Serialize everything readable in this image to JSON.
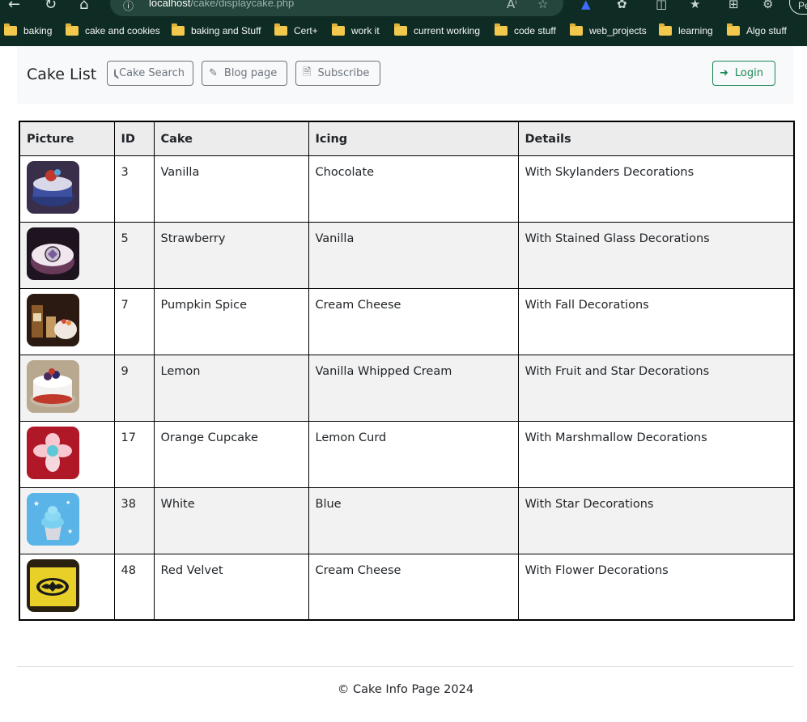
{
  "browser": {
    "url_host": "localhost",
    "url_path": "/cake/displaycake.php",
    "profile_label": "Pe",
    "bookmarks": [
      "baking",
      "cake and cookies",
      "baking and Stuff",
      "Cert+",
      "work it",
      "current working",
      "code stuff",
      "web_projects",
      "learning",
      "Algo stuff"
    ]
  },
  "navbar": {
    "brand": "Cake List",
    "search_label": "Cake Search",
    "blog_label": "Blog page",
    "subscribe_label": "Subscribe",
    "login_label": "Login",
    "login_color": "#198754"
  },
  "table": {
    "headers": [
      "Picture",
      "ID",
      "Cake",
      "Icing",
      "Details"
    ],
    "rows": [
      {
        "id": "3",
        "cake": "Vanilla",
        "icing": "Chocolate",
        "details": "With Skylanders Decorations",
        "picture": "cake-photo"
      },
      {
        "id": "5",
        "cake": "Strawberry",
        "icing": "Vanilla",
        "details": "With Stained Glass Decorations",
        "picture": "cake-photo"
      },
      {
        "id": "7",
        "cake": "Pumpkin Spice",
        "icing": "Cream Cheese",
        "details": "With Fall Decorations",
        "picture": "cake-photo"
      },
      {
        "id": "9",
        "cake": "Lemon",
        "icing": "Vanilla Whipped Cream",
        "details": "With Fruit and Star Decorations",
        "picture": "cake-photo"
      },
      {
        "id": "17",
        "cake": "Orange Cupcake",
        "icing": "Lemon Curd",
        "details": "With Marshmallow Decorations",
        "picture": "cake-photo"
      },
      {
        "id": "38",
        "cake": "White",
        "icing": "Blue",
        "details": "With Star Decorations",
        "picture": "cupcake-photo"
      },
      {
        "id": "48",
        "cake": "Red Velvet",
        "icing": "Cream Cheese",
        "details": "With Flower Decorations",
        "picture": "cake-photo"
      }
    ]
  },
  "footer": {
    "text": "© Cake Info Page 2024"
  }
}
